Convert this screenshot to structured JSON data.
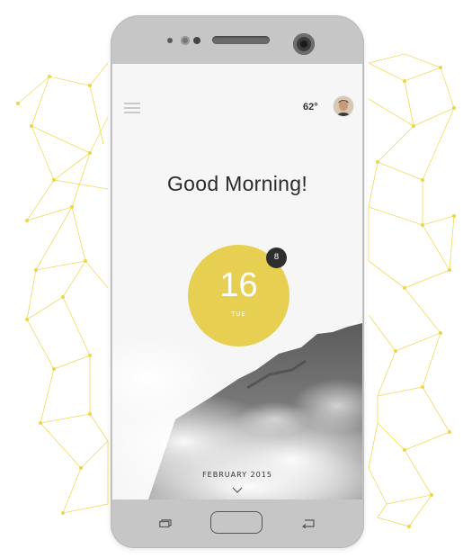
{
  "screen": {
    "greeting": "Good Morning!",
    "temperature": "62°",
    "date": {
      "day": "16",
      "weekday": "TUE",
      "notification_count": "8",
      "month_year": "FEBRUARY 2015"
    }
  },
  "icons": {
    "menu": "hamburger-menu-icon",
    "avatar": "user-avatar",
    "scroll": "chevron-down-icon",
    "recent_apps": "recent-apps-icon",
    "home": "home-button",
    "back": "back-arrow-icon"
  },
  "colors": {
    "accent": "#e6cf51",
    "badge": "#2e2e2e",
    "network_lines": "#efd54a",
    "phone_body": "#c6c6c6"
  }
}
